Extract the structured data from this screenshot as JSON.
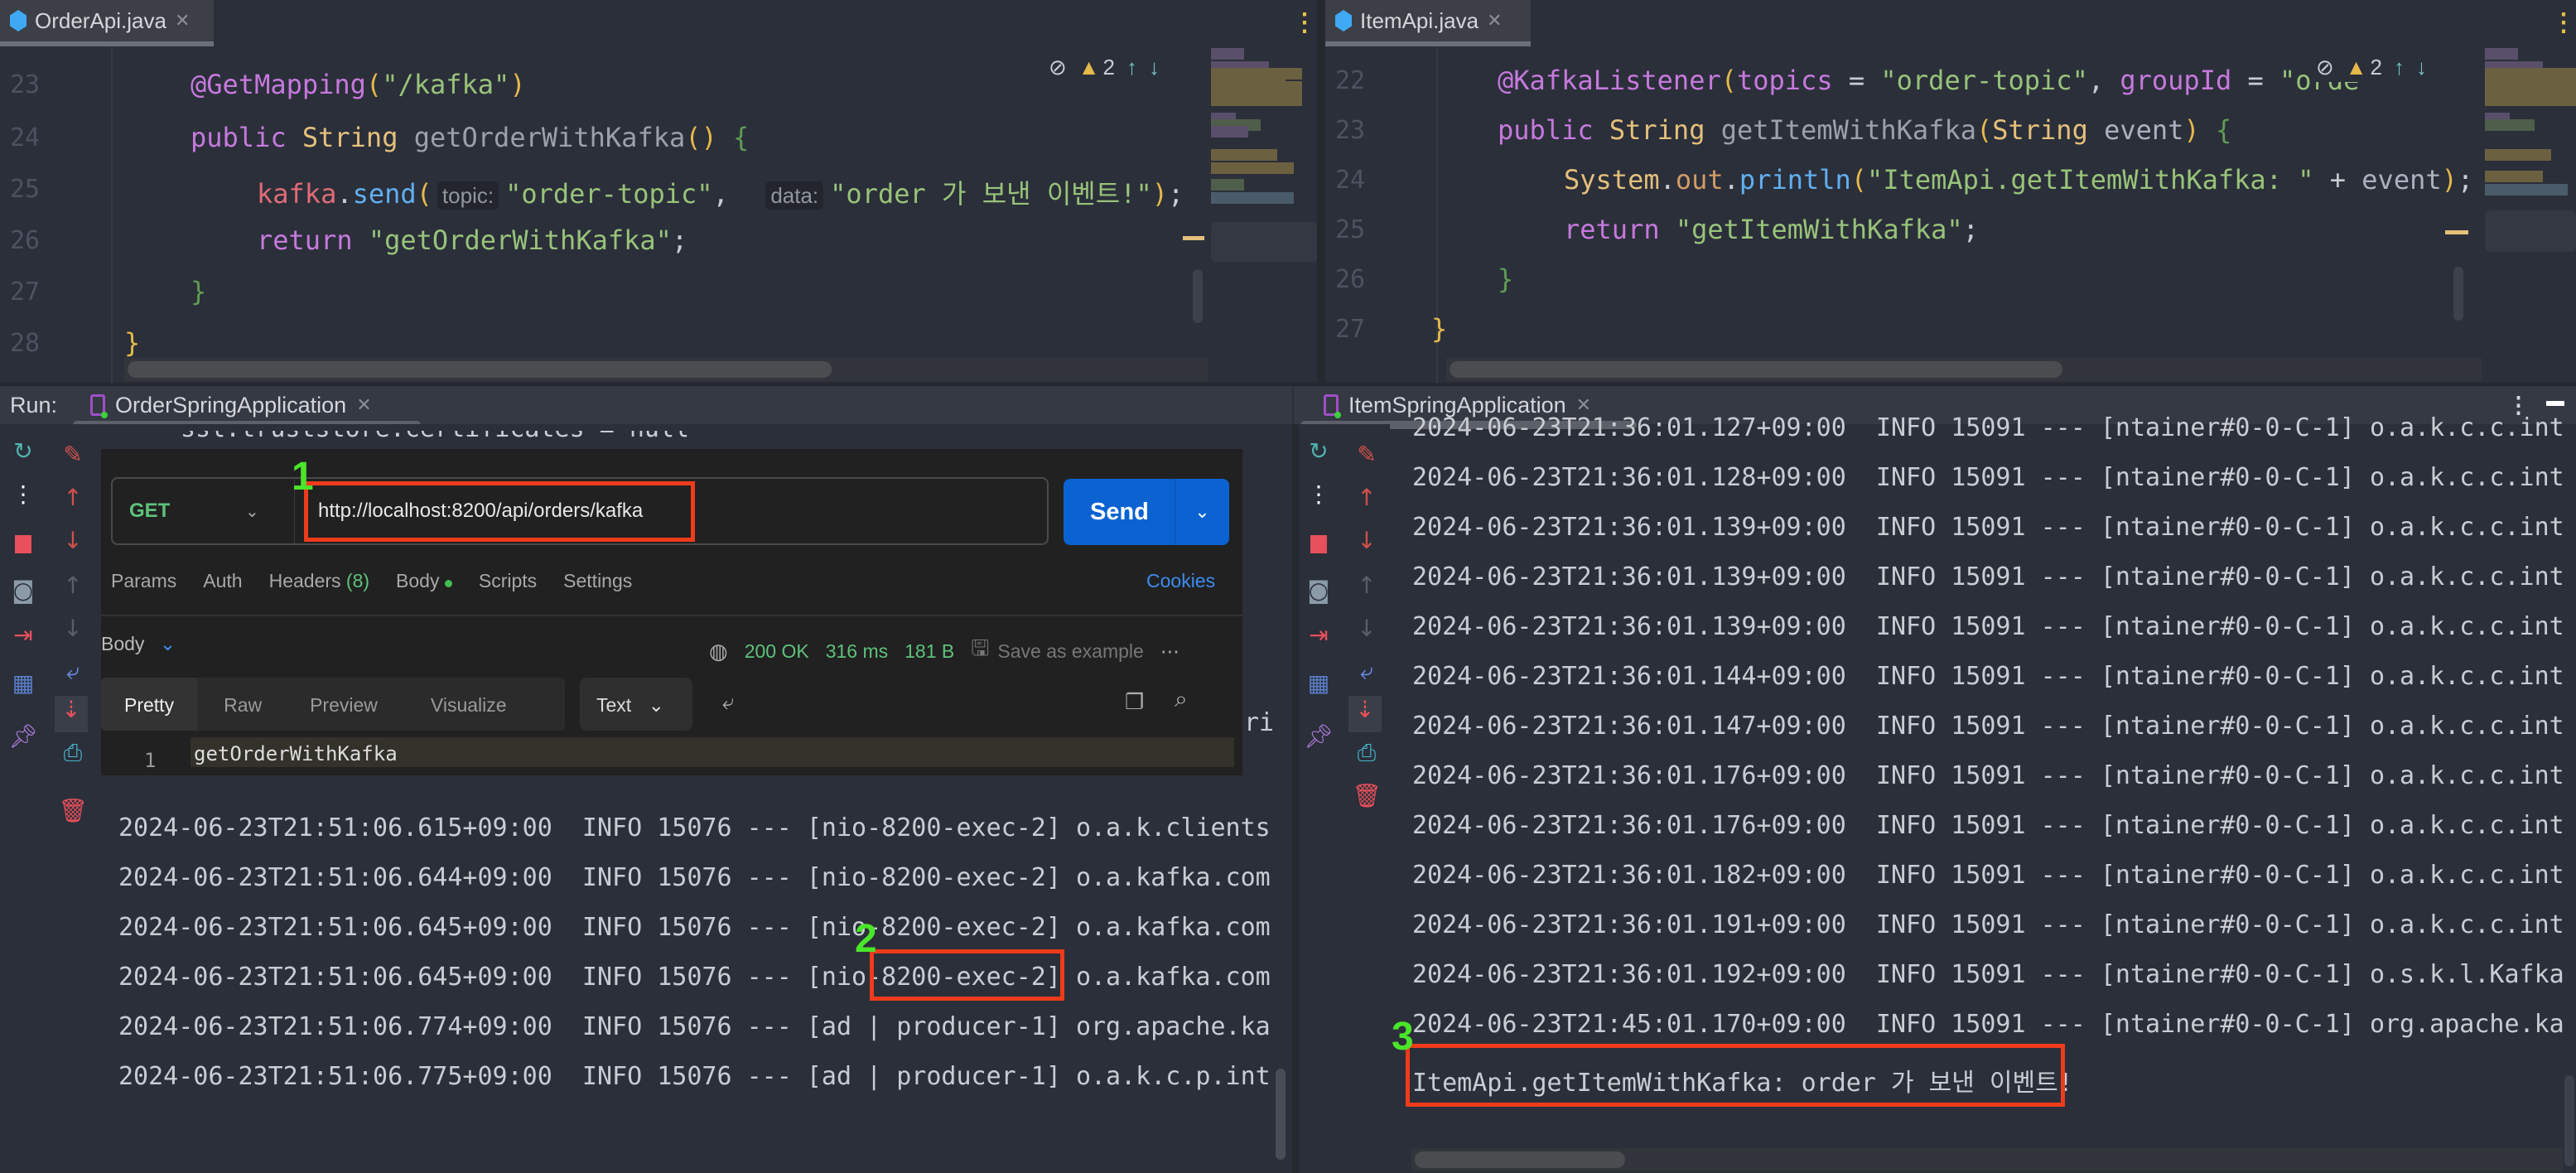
{
  "left_editor": {
    "tab": "OrderApi.java",
    "warnings": "2",
    "lines": [
      {
        "num": "23",
        "indent": 0,
        "tokens": [
          {
            "t": "@GetMapping",
            "c": "annotation"
          },
          {
            "t": "(",
            "c": "brace-y"
          },
          {
            "t": "\"/kafka\"",
            "c": "string"
          },
          {
            "t": ")",
            "c": "brace-y"
          }
        ]
      },
      {
        "num": "24",
        "indent": 0,
        "tokens": [
          {
            "t": "public ",
            "c": "keyword"
          },
          {
            "t": "String ",
            "c": "type"
          },
          {
            "t": "getOrderWithKafka",
            "c": "decl"
          },
          {
            "t": "()",
            "c": "brace-y"
          },
          {
            "t": " {",
            "c": "brace-g"
          }
        ]
      },
      {
        "num": "25",
        "indent": 1,
        "tokens": [
          {
            "t": "kafka",
            "c": "field"
          },
          {
            "t": ".",
            "c": "plain"
          },
          {
            "t": "send",
            "c": "method"
          },
          {
            "t": "(",
            "c": "brace-y"
          },
          {
            "t": "topic:",
            "c": "hint"
          },
          {
            "t": "\"order-topic\"",
            "c": "string"
          },
          {
            "t": ",  ",
            "c": "plain"
          },
          {
            "t": "data:",
            "c": "hint"
          },
          {
            "t": "\"order 가 보낸 이벤트!\"",
            "c": "string"
          },
          {
            "t": ")",
            "c": "brace-y"
          },
          {
            "t": ";",
            "c": "plain"
          }
        ]
      },
      {
        "num": "26",
        "indent": 1,
        "tokens": [
          {
            "t": "return ",
            "c": "keyword"
          },
          {
            "t": "\"getOrderWithKafka\"",
            "c": "string"
          },
          {
            "t": ";",
            "c": "plain"
          }
        ]
      },
      {
        "num": "27",
        "indent": 0,
        "tokens": [
          {
            "t": "}",
            "c": "brace-g"
          }
        ]
      },
      {
        "num": "28",
        "indent": -1,
        "tokens": [
          {
            "t": "}",
            "c": "brace-y"
          }
        ]
      }
    ]
  },
  "right_editor": {
    "tab": "ItemApi.java",
    "warnings": "2",
    "lines": [
      {
        "num": "22",
        "indent": 0,
        "tokens": [
          {
            "t": "@KafkaListener",
            "c": "annotation"
          },
          {
            "t": "(",
            "c": "brace-y"
          },
          {
            "t": "topics",
            "c": "keyword"
          },
          {
            "t": " = ",
            "c": "plain"
          },
          {
            "t": "\"order-topic\"",
            "c": "string"
          },
          {
            "t": ", ",
            "c": "plain"
          },
          {
            "t": "groupId",
            "c": "keyword"
          },
          {
            "t": " = ",
            "c": "plain"
          },
          {
            "t": "\"orde",
            "c": "string"
          }
        ]
      },
      {
        "num": "23",
        "indent": 0,
        "tokens": [
          {
            "t": "public ",
            "c": "keyword"
          },
          {
            "t": "String ",
            "c": "type"
          },
          {
            "t": "getItemWithKafka",
            "c": "decl"
          },
          {
            "t": "(",
            "c": "brace-y"
          },
          {
            "t": "String ",
            "c": "type"
          },
          {
            "t": "event",
            "c": "param"
          },
          {
            "t": ")",
            "c": "brace-y"
          },
          {
            "t": " {",
            "c": "brace-g"
          }
        ]
      },
      {
        "num": "24",
        "indent": 1,
        "tokens": [
          {
            "t": "System",
            "c": "type"
          },
          {
            "t": ".",
            "c": "plain"
          },
          {
            "t": "out",
            "c": "static-field"
          },
          {
            "t": ".",
            "c": "plain"
          },
          {
            "t": "println",
            "c": "method"
          },
          {
            "t": "(",
            "c": "brace-y"
          },
          {
            "t": "\"ItemApi.getItemWithKafka: \"",
            "c": "string"
          },
          {
            "t": " + ",
            "c": "plain"
          },
          {
            "t": "event",
            "c": "param"
          },
          {
            "t": ")",
            "c": "brace-y"
          },
          {
            "t": ";",
            "c": "plain"
          }
        ]
      },
      {
        "num": "25",
        "indent": 1,
        "tokens": [
          {
            "t": "return ",
            "c": "keyword"
          },
          {
            "t": "\"getItemWithKafka\"",
            "c": "string"
          },
          {
            "t": ";",
            "c": "plain"
          }
        ]
      },
      {
        "num": "26",
        "indent": 0,
        "tokens": [
          {
            "t": "}",
            "c": "brace-g"
          }
        ]
      },
      {
        "num": "27",
        "indent": -1,
        "tokens": [
          {
            "t": "}",
            "c": "brace-y"
          }
        ]
      }
    ]
  },
  "run": {
    "label": "Run:",
    "left_tab": "OrderSpringApplication",
    "right_tab": "ItemSpringApplication",
    "left_partial_line": "ssl.truststore.certificates = null",
    "left_partial_right": "ri",
    "left_logs": [
      "2024-06-23T21:51:06.615+09:00  INFO 15076 --- [nio-8200-exec-2] o.a.k.clients",
      "2024-06-23T21:51:06.644+09:00  INFO 15076 --- [nio-8200-exec-2] o.a.kafka.com",
      "2024-06-23T21:51:06.645+09:00  INFO 15076 --- [nio-8200-exec-2] o.a.kafka.com",
      "2024-06-23T21:51:06.645+09:00  INFO 15076 --- [nio-8200-exec-2] o.a.kafka.com",
      "2024-06-23T21:51:06.774+09:00  INFO 15076 --- [ad | producer-1] org.apache.ka",
      "2024-06-23T21:51:06.775+09:00  INFO 15076 --- [ad | producer-1] o.a.k.c.p.int"
    ],
    "right_logs": [
      "2024-06-23T21:36:01.127+09:00  INFO 15091 --- [ntainer#0-0-C-1] o.a.k.c.c.int",
      "2024-06-23T21:36:01.128+09:00  INFO 15091 --- [ntainer#0-0-C-1] o.a.k.c.c.int",
      "2024-06-23T21:36:01.139+09:00  INFO 15091 --- [ntainer#0-0-C-1] o.a.k.c.c.int",
      "2024-06-23T21:36:01.139+09:00  INFO 15091 --- [ntainer#0-0-C-1] o.a.k.c.c.int",
      "2024-06-23T21:36:01.139+09:00  INFO 15091 --- [ntainer#0-0-C-1] o.a.k.c.c.int",
      "2024-06-23T21:36:01.144+09:00  INFO 15091 --- [ntainer#0-0-C-1] o.a.k.c.c.int",
      "2024-06-23T21:36:01.147+09:00  INFO 15091 --- [ntainer#0-0-C-1] o.a.k.c.c.int",
      "2024-06-23T21:36:01.176+09:00  INFO 15091 --- [ntainer#0-0-C-1] o.a.k.c.c.int",
      "2024-06-23T21:36:01.176+09:00  INFO 15091 --- [ntainer#0-0-C-1] o.a.k.c.c.int",
      "2024-06-23T21:36:01.182+09:00  INFO 15091 --- [ntainer#0-0-C-1] o.a.k.c.c.int",
      "2024-06-23T21:36:01.191+09:00  INFO 15091 --- [ntainer#0-0-C-1] o.a.k.c.c.int",
      "2024-06-23T21:36:01.192+09:00  INFO 15091 --- [ntainer#0-0-C-1] o.s.k.l.Kafka",
      "2024-06-23T21:45:01.170+09:00  INFO 15091 --- [ntainer#0-0-C-1] org.apache.ka"
    ],
    "right_output": "ItemApi.getItemWithKafka: order 가 보낸 이벤트!"
  },
  "postman": {
    "method": "GET",
    "url": "http://localhost:8200/api/orders/kafka",
    "send": "Send",
    "tabs": [
      "Params",
      "Auth",
      "Headers",
      "Body",
      "Scripts",
      "Settings"
    ],
    "headers_count": "(8)",
    "cookies": "Cookies",
    "body_label": "Body",
    "status": "200 OK",
    "time": "316 ms",
    "size": "181 B",
    "save_example": "Save as example",
    "view_tabs": [
      "Pretty",
      "Raw",
      "Preview",
      "Visualize"
    ],
    "format": "Text",
    "response_line_num": "1",
    "response_body": "getOrderWithKafka"
  },
  "annotations": [
    "1",
    "2",
    "3"
  ],
  "colors": {
    "send": "#0b63d1",
    "status_ok": "#5ec27a",
    "cookies": "#3d8cf0",
    "highlight_box": "#ee3b1c",
    "marker": "#4be52a"
  }
}
